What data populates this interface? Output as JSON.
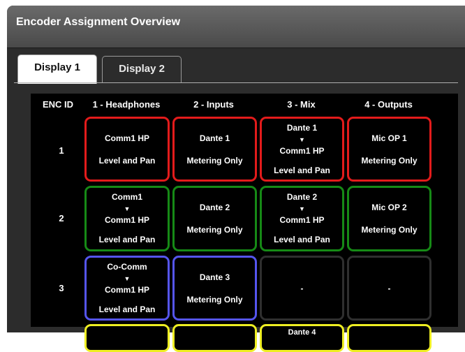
{
  "window": {
    "title": "Encoder Assignment Overview"
  },
  "tabs": [
    {
      "label": "Display 1",
      "active": true
    },
    {
      "label": "Display 2",
      "active": false
    }
  ],
  "colors": {
    "red": "#e31b1b",
    "green": "#168a16",
    "blue": "#5555ee",
    "yellow": "#eeee22",
    "empty": "#2f2f2f"
  },
  "table": {
    "headers": [
      "ENC ID",
      "1 - Headphones",
      "2 - Inputs",
      "3 - Mix",
      "4 - Outputs"
    ],
    "rows": [
      {
        "id": "1",
        "cells": [
          {
            "src": "",
            "dest": "Comm1 HP",
            "mode": "Level and Pan"
          },
          {
            "src": "",
            "dest": "Dante 1",
            "mode": "Metering Only"
          },
          {
            "src": "Dante 1",
            "dest": "Comm1 HP",
            "mode": "Level and Pan"
          },
          {
            "src": "",
            "dest": "Mic OP 1",
            "mode": "Metering Only"
          }
        ]
      },
      {
        "id": "2",
        "cells": [
          {
            "src": "Comm1",
            "dest": "Comm1 HP",
            "mode": "Level and Pan"
          },
          {
            "src": "",
            "dest": "Dante 2",
            "mode": "Metering Only"
          },
          {
            "src": "Dante 2",
            "dest": "Comm1 HP",
            "mode": "Level and Pan"
          },
          {
            "src": "",
            "dest": "Mic OP 2",
            "mode": "Metering Only"
          }
        ]
      },
      {
        "id": "3",
        "cells": [
          {
            "src": "Co-Comm",
            "dest": "Comm1 HP",
            "mode": "Level and Pan"
          },
          {
            "src": "",
            "dest": "Dante 3",
            "mode": "Metering Only"
          },
          {
            "src": "",
            "dest": "-",
            "mode": ""
          },
          {
            "src": "",
            "dest": "-",
            "mode": ""
          }
        ]
      },
      {
        "id": "",
        "cells": [
          {
            "src": "",
            "dest": "",
            "mode": ""
          },
          {
            "src": "",
            "dest": "",
            "mode": ""
          },
          {
            "src": "Dante 4",
            "dest": "",
            "mode": ""
          },
          {
            "src": "",
            "dest": "",
            "mode": ""
          }
        ]
      }
    ]
  }
}
